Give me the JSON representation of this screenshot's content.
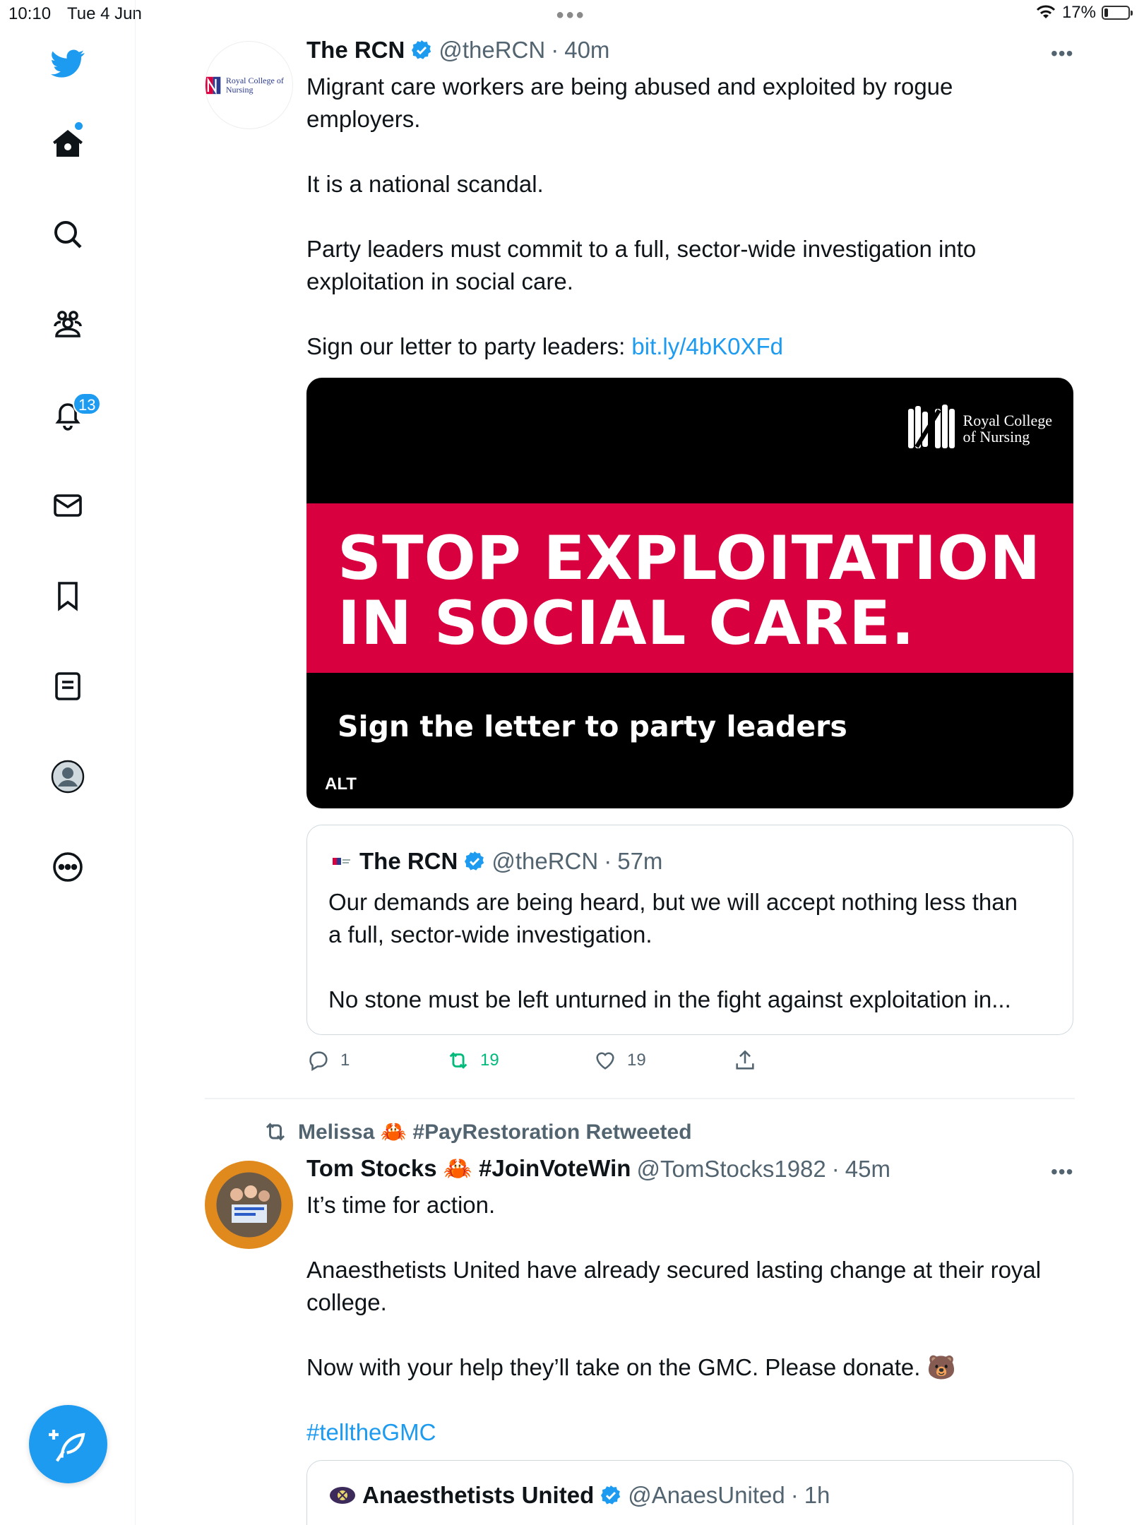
{
  "status_bar": {
    "time": "10:10",
    "date": "Tue 4 Jun",
    "battery": "17%",
    "battery_level": 0.17
  },
  "sidebar": {
    "items": [
      {
        "name": "twitter-logo-icon"
      },
      {
        "name": "home-icon"
      },
      {
        "name": "search-icon"
      },
      {
        "name": "communities-icon"
      },
      {
        "name": "notifications-icon"
      },
      {
        "name": "messages-icon"
      },
      {
        "name": "bookmarks-icon"
      },
      {
        "name": "lists-icon"
      },
      {
        "name": "profile-icon"
      },
      {
        "name": "more-icon"
      }
    ],
    "notification_count": "13",
    "compose": "compose-icon"
  },
  "colors": {
    "accent": "#1d9bf0",
    "text": "#0f1419",
    "secondary": "#536471",
    "retweet_green": "#00ba7c",
    "banner_red": "#d9003f"
  },
  "tweet1": {
    "name": "The RCN",
    "handle": "@theRCN",
    "time": "40m",
    "avatar_text": "Royal College of Nursing",
    "text": "Migrant care workers are being abused and exploited by rogue\nemployers.\n\nIt is a national scandal.\n\nParty leaders must commit to a full, sector-wide investigation into\nexploitation in social care.\n\nSign our letter to party leaders: ",
    "link": "bit.ly/4bK0XFd",
    "media": {
      "logo_line1": "Royal College",
      "logo_line2": "of Nursing",
      "headline_line1": "STOP EXPLOITATION",
      "headline_line2": "IN SOCIAL CARE.",
      "subline": "Sign the letter to party leaders",
      "alt_badge": "ALT"
    },
    "quote": {
      "name": "The RCN",
      "handle": "@theRCN",
      "time": "57m",
      "text": "Our demands are being heard, but we will accept nothing less than\na full, sector-wide investigation.\n\nNo stone must be left unturned in the fight against exploitation in..."
    },
    "actions": {
      "replies": "1",
      "retweets": "19",
      "likes": "19"
    }
  },
  "tweet2": {
    "retweeted_by": "Melissa 🦀 #PayRestoration Retweeted",
    "name": "Tom Stocks 🦀 #JoinVoteWin",
    "handle": "@TomStocks1982",
    "time": "45m",
    "text": "It’s time for action.\n\nAnaesthetists United have already secured lasting change at their royal\ncollege.\n\nNow with your help they’ll take on the GMC. Please donate. 🐻\n\n",
    "hashtag": "#telltheGMC",
    "quote": {
      "name": "Anaesthetists United",
      "handle": "@AnaesUnited",
      "time": "1h"
    }
  }
}
